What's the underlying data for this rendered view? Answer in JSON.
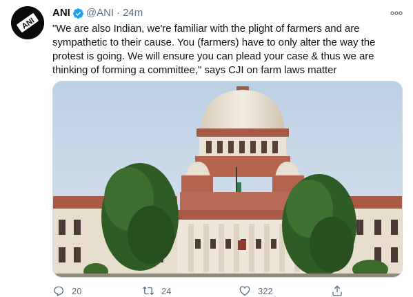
{
  "tweet": {
    "display_name": "ANI",
    "handle": "@ANI",
    "separator": "·",
    "time": "24m",
    "avatar_text": "ANI",
    "text": "\"We are also Indian, we're familiar with the plight of farmers and are sympathetic to their cause. You (farmers) have to only alter the way the protest is going. We will ensure you can plead your case & thus we are thinking of forming a committee,\" says CJI on farm laws matter",
    "media_description_icon": "supreme-court-building-photo"
  },
  "actions": {
    "reply_count": "20",
    "retweet_count": "24",
    "like_count": "322"
  },
  "colors": {
    "verified_blue": "#1da1f2",
    "secondary_text": "#5b7083",
    "border": "#cfd9de"
  }
}
